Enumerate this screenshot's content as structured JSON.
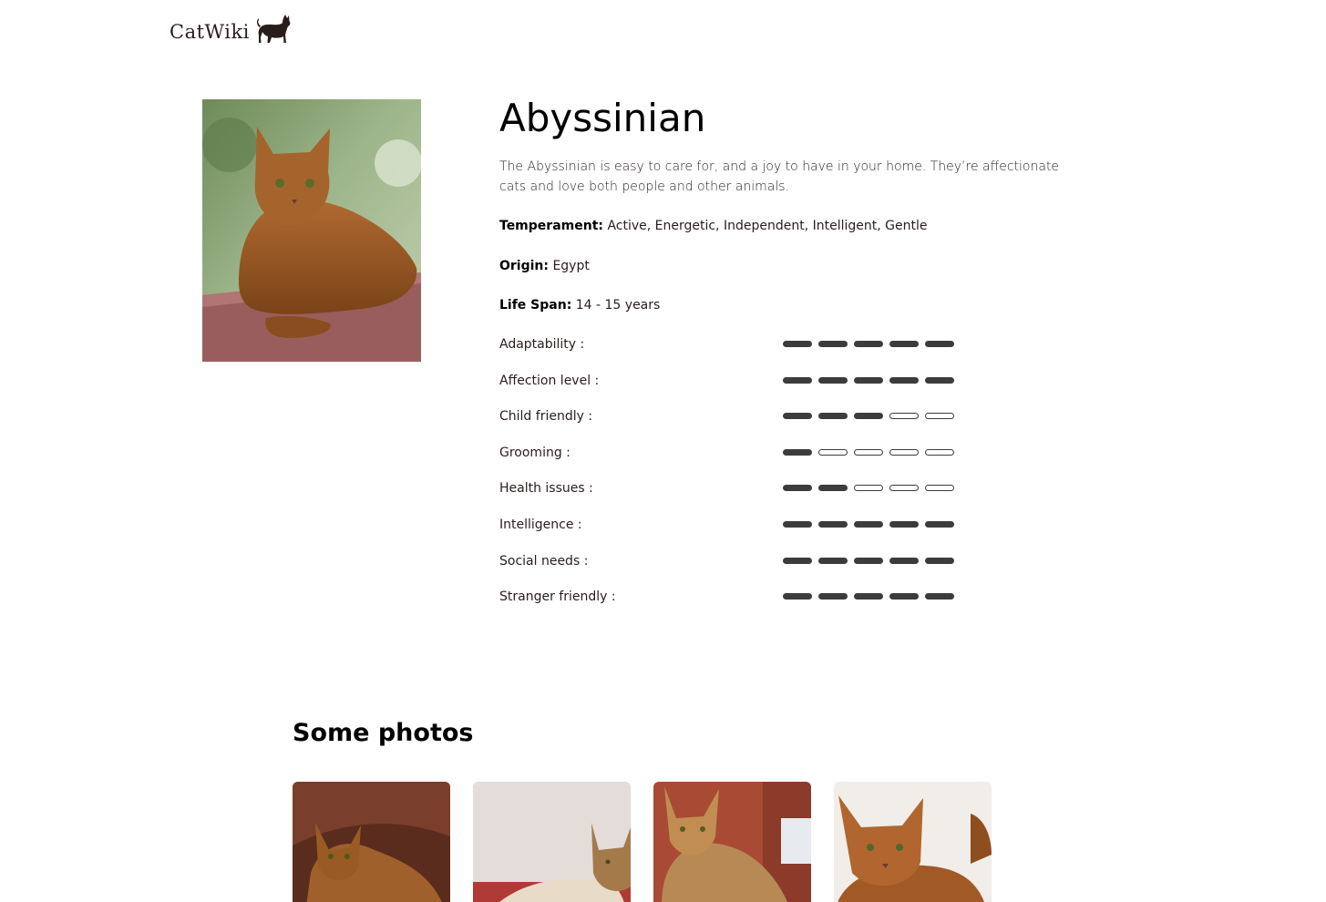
{
  "header": {
    "logo_text": "CatWiki",
    "logo_icon": "cat-silhouette-icon"
  },
  "breed": {
    "name": "Abyssinian",
    "description": "The Abyssinian is easy to care for, and a joy to have in your home. They’re affectionate cats and love both people and other animals.",
    "temperament_label": "Temperament:",
    "temperament": "Active, Energetic, Independent, Intelligent, Gentle",
    "origin_label": "Origin:",
    "origin": "Egypt",
    "life_span_label": "Life Span:",
    "life_span": "14 - 15 years"
  },
  "ratings": [
    {
      "label": "Adaptability :",
      "value": 5,
      "max": 5
    },
    {
      "label": "Affection level :",
      "value": 5,
      "max": 5
    },
    {
      "label": "Child friendly :",
      "value": 3,
      "max": 5
    },
    {
      "label": "Grooming :",
      "value": 1,
      "max": 5
    },
    {
      "label": "Health issues :",
      "value": 2,
      "max": 5
    },
    {
      "label": "Intelligence :",
      "value": 5,
      "max": 5
    },
    {
      "label": "Social needs :",
      "value": 5,
      "max": 5
    },
    {
      "label": "Stranger friendly :",
      "value": 5,
      "max": 5
    }
  ],
  "photos": {
    "title": "Some photos"
  },
  "colors": {
    "text": "#291d1c",
    "bar_filled": "#3c3c3c",
    "bar_empty": "#ffffff",
    "cat_fur": "#9a5a24"
  }
}
